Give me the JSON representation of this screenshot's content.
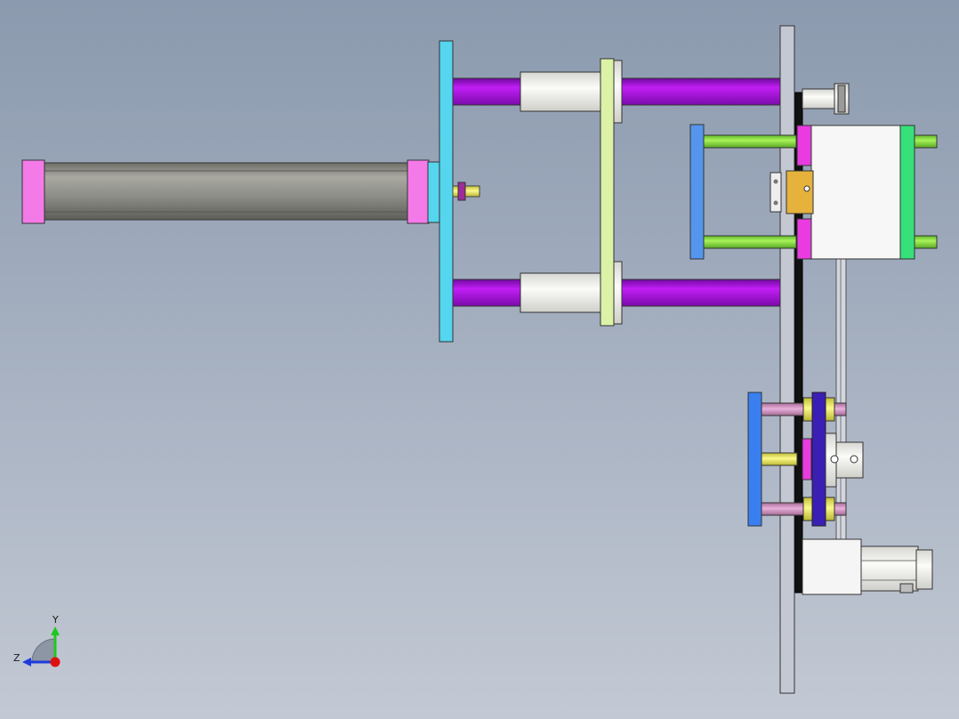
{
  "view": {
    "type": "cad-assembly-side-view",
    "background_top": "#8b9aae",
    "background_bottom": "#c3c9d4"
  },
  "triad": {
    "y_label": "Y",
    "z_label": "Z",
    "y_color": "#1ec81e",
    "z_color": "#1e3cdc",
    "x_color": "#e01010"
  },
  "colors": {
    "cylinder_cap": "#f47ae8",
    "cylinder_body": "#9a9a94",
    "cyan_plate": "#55d5ee",
    "rod_purple": "#b30ee6",
    "bushing_white": "#f2f2ee",
    "green_plate": "#dcf2a6",
    "frame_plate": "#c4c8d2",
    "belt_black": "#111111",
    "block_white": "#f7f7f7",
    "lime_rod": "#8ee83c",
    "blue_plate": "#5595ee",
    "green_end": "#36e07a",
    "magenta_block": "#e83ce0",
    "gold_part": "#e6b23c",
    "blue_bar": "#3a7ff0",
    "indigo_bar": "#3b1fb5",
    "pink_rod": "#d795c8",
    "yellow_rod": "#f2f06a",
    "motor_white": "#f5f5f5"
  }
}
